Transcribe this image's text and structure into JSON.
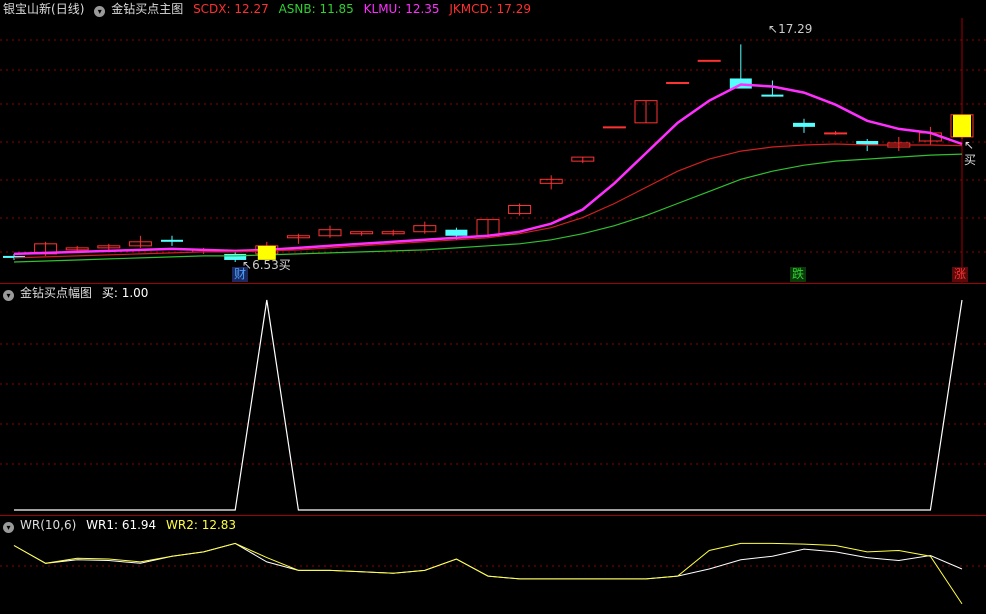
{
  "main_panel": {
    "stock_name": "银宝山新",
    "period": "(日线)",
    "indicator_name": "金钻买点主图",
    "indicators": [
      {
        "label": "SCDX: 12.27",
        "color": "#ff3030"
      },
      {
        "label": "ASNB: 11.85",
        "color": "#30d030"
      },
      {
        "label": "KLMU: 12.35",
        "color": "#ff30ff"
      },
      {
        "label": "JKMCD: 17.29",
        "color": "#ff3030"
      }
    ],
    "high_marker": "17.29",
    "low_marker": "6.53",
    "buy_label": "买",
    "signals": [
      {
        "text": "财",
        "color": "#4aa0ff"
      },
      {
        "text": "跌",
        "color": "#30d030"
      },
      {
        "text": "涨",
        "color": "#ff3030"
      }
    ]
  },
  "sub_panel_1": {
    "title": "金钻买点幅图",
    "value_label": "买: 1.00"
  },
  "sub_panel_2": {
    "title": "WR(10,6)",
    "wr1_label": "WR1: 61.94",
    "wr2_label": "WR2: 12.83"
  },
  "colors": {
    "up": "#ff3232",
    "down": "#54ffff",
    "klmu": "#ff30ff",
    "scdx": "#d02020",
    "asnb": "#30c030",
    "buy_box": "#ffff00",
    "wr1": "#ffffff",
    "wr2": "#ffff40"
  },
  "chart_data": [
    {
      "type": "candlestick",
      "title": "银宝山新(日线) 金钻买点主图",
      "candles": [
        {
          "o": 6.8,
          "h": 6.9,
          "l": 6.6,
          "c": 6.7
        },
        {
          "o": 6.9,
          "h": 7.5,
          "l": 6.8,
          "c": 7.4
        },
        {
          "o": 7.1,
          "h": 7.3,
          "l": 7.0,
          "c": 7.2
        },
        {
          "o": 7.2,
          "h": 7.4,
          "l": 7.1,
          "c": 7.3
        },
        {
          "o": 7.3,
          "h": 7.8,
          "l": 7.2,
          "c": 7.5
        },
        {
          "o": 7.6,
          "h": 7.8,
          "l": 7.3,
          "c": 7.5
        },
        {
          "o": 7.0,
          "h": 7.2,
          "l": 6.9,
          "c": 7.1
        },
        {
          "o": 6.9,
          "h": 7.0,
          "l": 6.5,
          "c": 6.6
        },
        {
          "o": 6.9,
          "h": 7.5,
          "l": 6.8,
          "c": 7.3
        },
        {
          "o": 7.7,
          "h": 7.9,
          "l": 7.4,
          "c": 7.8
        },
        {
          "o": 7.8,
          "h": 8.3,
          "l": 7.7,
          "c": 8.1
        },
        {
          "o": 7.9,
          "h": 8.0,
          "l": 7.8,
          "c": 8.0
        },
        {
          "o": 7.9,
          "h": 8.1,
          "l": 7.8,
          "c": 8.0
        },
        {
          "o": 8.0,
          "h": 8.5,
          "l": 7.9,
          "c": 8.3
        },
        {
          "o": 8.1,
          "h": 8.2,
          "l": 7.6,
          "c": 7.8
        },
        {
          "o": 7.8,
          "h": 8.6,
          "l": 7.7,
          "c": 8.6
        },
        {
          "o": 8.9,
          "h": 9.4,
          "l": 8.8,
          "c": 9.3
        },
        {
          "o": 10.4,
          "h": 10.8,
          "l": 10.1,
          "c": 10.6
        },
        {
          "o": 11.5,
          "h": 11.7,
          "l": 11.4,
          "c": 11.7
        },
        {
          "o": 13.2,
          "h": 13.2,
          "l": 13.2,
          "c": 13.2
        },
        {
          "o": 13.4,
          "h": 14.5,
          "l": 13.4,
          "c": 14.5
        },
        {
          "o": 15.4,
          "h": 15.4,
          "l": 15.4,
          "c": 15.4
        },
        {
          "o": 16.5,
          "h": 16.5,
          "l": 16.5,
          "c": 16.5
        },
        {
          "o": 15.6,
          "h": 17.29,
          "l": 15.4,
          "c": 15.1
        },
        {
          "o": 14.8,
          "h": 15.5,
          "l": 14.7,
          "c": 14.7
        },
        {
          "o": 13.4,
          "h": 13.6,
          "l": 12.9,
          "c": 13.2
        },
        {
          "o": 12.9,
          "h": 13.0,
          "l": 12.8,
          "c": 12.9
        },
        {
          "o": 12.5,
          "h": 12.6,
          "l": 12.0,
          "c": 12.3
        },
        {
          "o": 12.2,
          "h": 12.7,
          "l": 12.0,
          "c": 12.4
        },
        {
          "o": 12.5,
          "h": 13.2,
          "l": 12.3,
          "c": 12.9
        },
        {
          "o": 12.7,
          "h": 13.8,
          "l": 12.6,
          "c": 13.8
        }
      ],
      "series": [
        {
          "name": "KLMU",
          "values": [
            6.9,
            6.95,
            7.0,
            7.05,
            7.1,
            7.15,
            7.1,
            7.05,
            7.1,
            7.2,
            7.3,
            7.4,
            7.5,
            7.6,
            7.7,
            7.8,
            8.0,
            8.4,
            9.1,
            10.4,
            11.9,
            13.4,
            14.5,
            15.3,
            15.2,
            14.9,
            14.3,
            13.5,
            13.1,
            12.9,
            12.35
          ]
        },
        {
          "name": "SCDX",
          "values": [
            6.7,
            6.75,
            6.8,
            6.85,
            6.9,
            6.95,
            7.0,
            7.0,
            7.05,
            7.1,
            7.2,
            7.3,
            7.4,
            7.5,
            7.6,
            7.7,
            7.9,
            8.2,
            8.7,
            9.4,
            10.2,
            11.0,
            11.6,
            12.0,
            12.2,
            12.3,
            12.35,
            12.3,
            12.3,
            12.3,
            12.27
          ]
        },
        {
          "name": "ASNB",
          "values": [
            6.5,
            6.55,
            6.6,
            6.65,
            6.7,
            6.75,
            6.8,
            6.8,
            6.85,
            6.9,
            6.95,
            7.0,
            7.05,
            7.1,
            7.2,
            7.3,
            7.4,
            7.6,
            7.9,
            8.3,
            8.8,
            9.4,
            10.0,
            10.6,
            11.0,
            11.3,
            11.5,
            11.6,
            11.7,
            11.8,
            11.85
          ]
        }
      ],
      "ylim": [
        6.3,
        18.5
      ]
    },
    {
      "type": "line",
      "title": "金钻买点幅图",
      "series": [
        {
          "name": "买",
          "values": [
            0,
            0,
            0,
            0,
            0,
            0,
            0,
            0,
            1,
            0,
            0,
            0,
            0,
            0,
            0,
            0,
            0,
            0,
            0,
            0,
            0,
            0,
            0,
            0,
            0,
            0,
            0,
            0,
            0,
            0,
            1
          ]
        }
      ],
      "ylim": [
        0,
        1
      ]
    },
    {
      "type": "line",
      "title": "WR(10,6)",
      "series": [
        {
          "name": "WR1",
          "values": [
            95,
            70,
            75,
            74,
            70,
            80,
            86,
            98,
            72,
            60,
            60,
            58,
            56,
            60,
            76,
            52,
            48,
            48,
            48,
            48,
            48,
            52,
            62,
            75,
            80,
            90,
            86,
            78,
            74,
            81,
            61.94
          ]
        },
        {
          "name": "WR2",
          "values": [
            95,
            70,
            77,
            76,
            72,
            80,
            86,
            98,
            78,
            60,
            60,
            58,
            56,
            60,
            76,
            52,
            48,
            48,
            48,
            48,
            48,
            52,
            88,
            98,
            98,
            97,
            95,
            86,
            88,
            80,
            12.83
          ]
        }
      ],
      "ylim": [
        0,
        100
      ]
    }
  ]
}
